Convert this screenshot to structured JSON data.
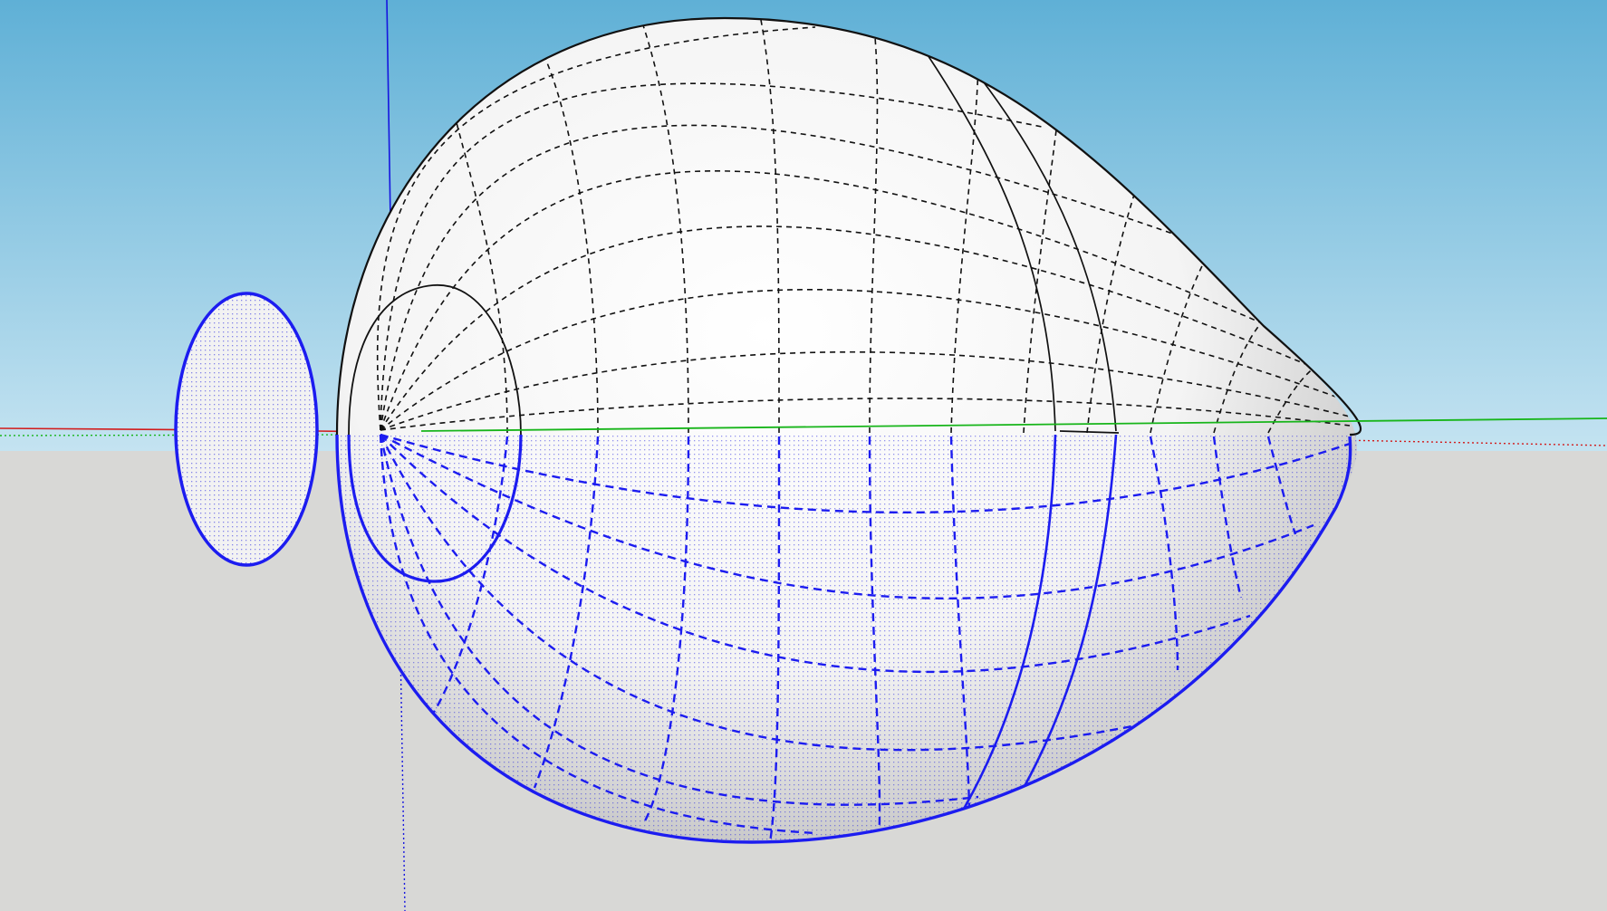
{
  "viewport": {
    "label": "",
    "colors": {
      "sky_top": "#5fb0d6",
      "sky_bottom": "#c4e3f1",
      "ground": "#d8d8d6",
      "axis_red": "#d21c1c",
      "axis_green": "#17b51a",
      "axis_blue": "#1515e0",
      "selection_blue": "#1c1cf0",
      "edge": "#111111"
    },
    "objects": [
      {
        "name": "selected-circle-face",
        "selected": true
      },
      {
        "name": "revolved-egg-solid",
        "selected": "lower-half"
      }
    ]
  }
}
